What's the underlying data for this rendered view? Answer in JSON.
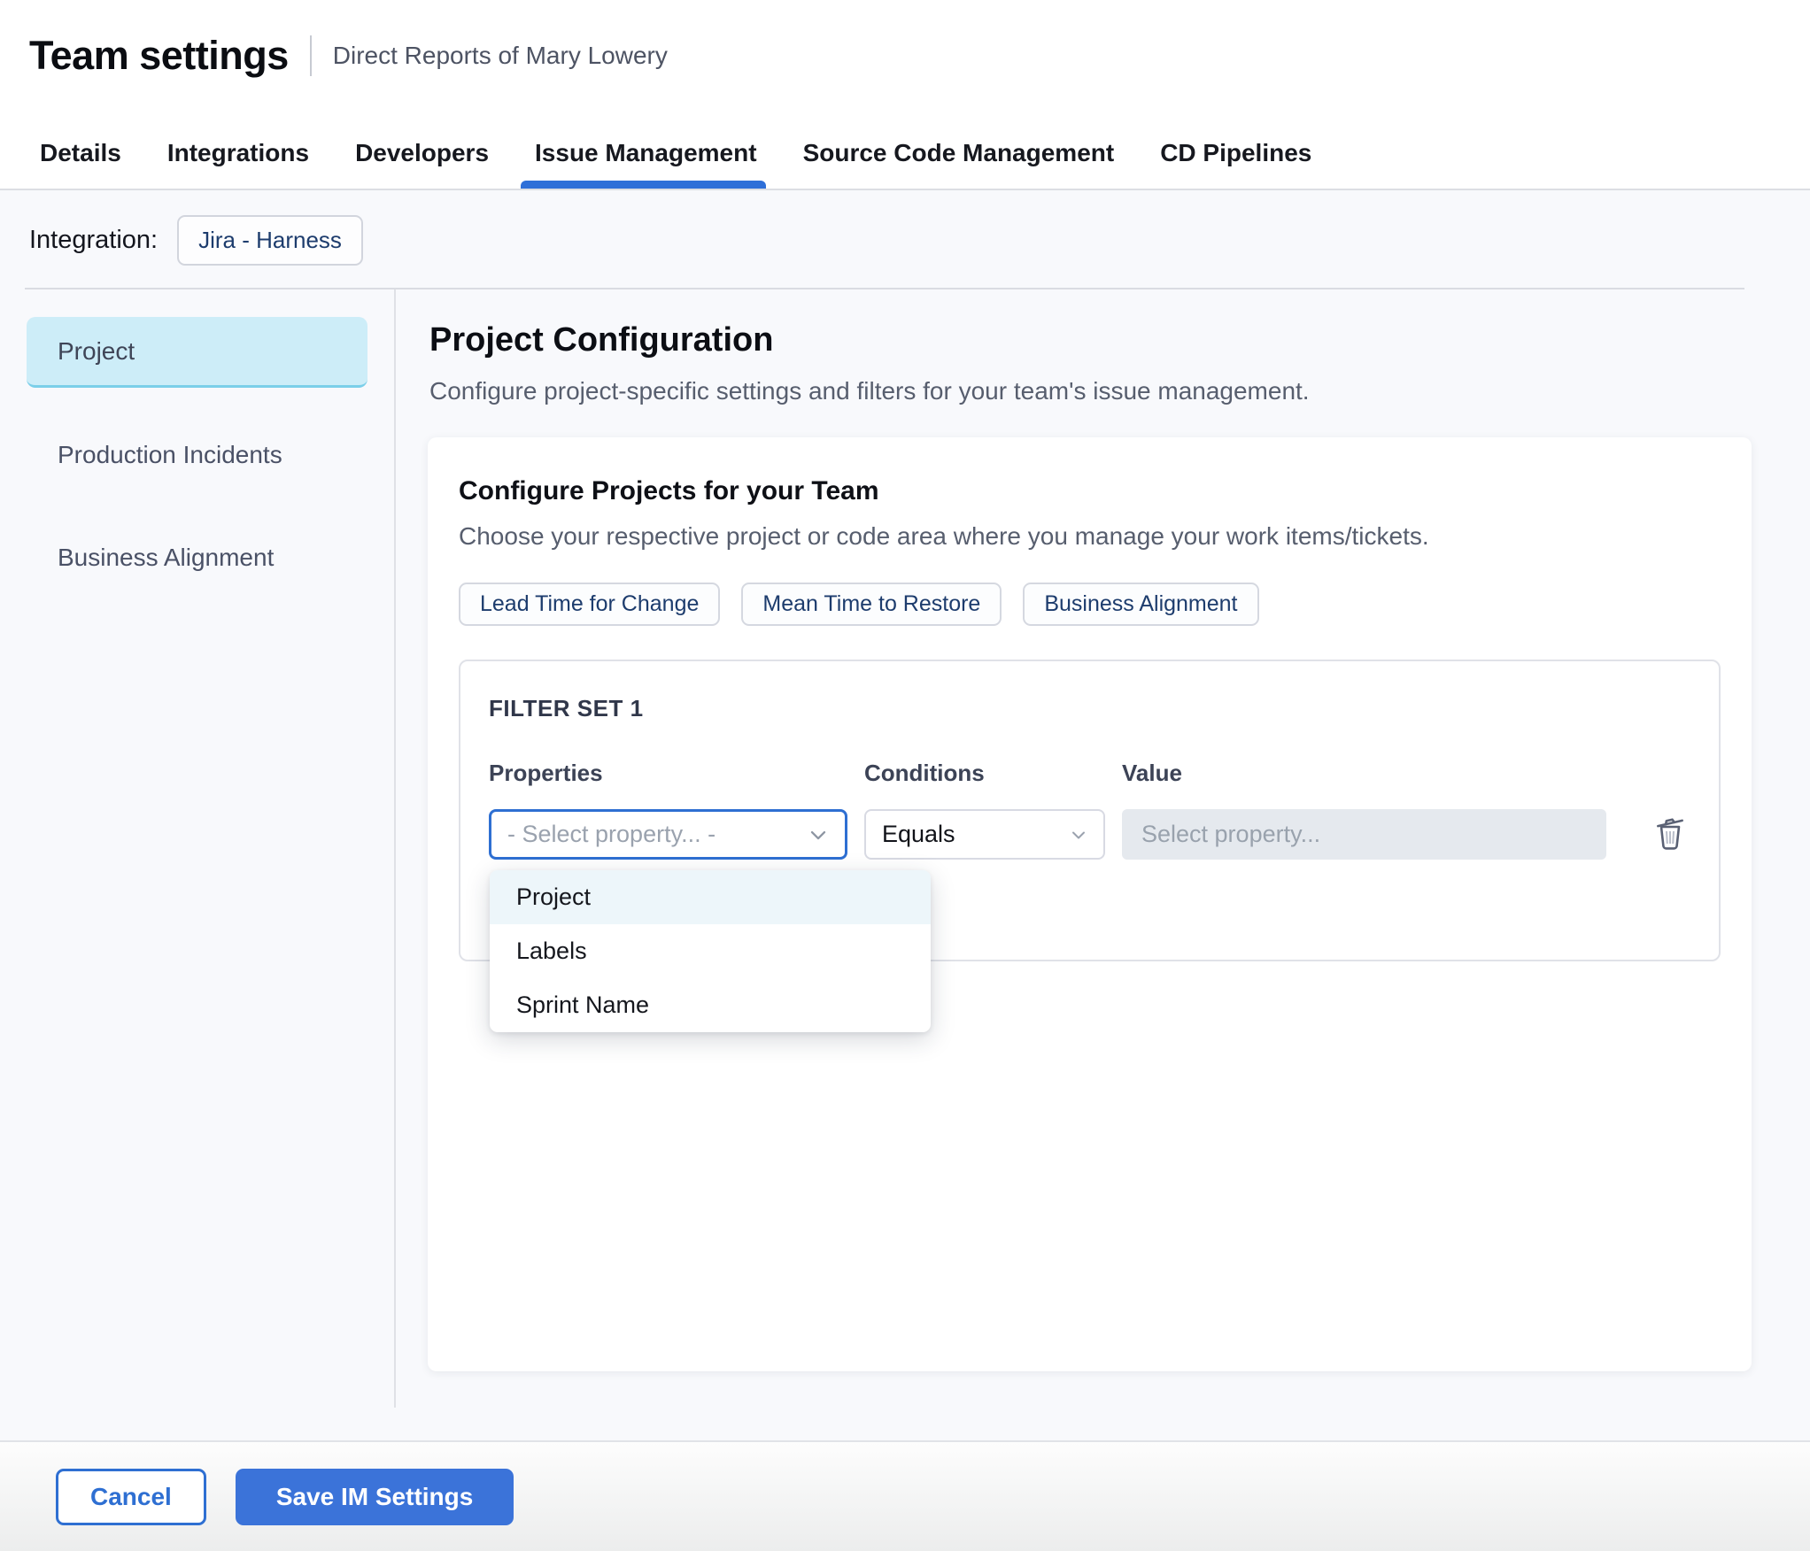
{
  "header": {
    "title": "Team settings",
    "subtitle": "Direct Reports of Mary Lowery"
  },
  "tabs": [
    {
      "label": "Details",
      "active": false
    },
    {
      "label": "Integrations",
      "active": false
    },
    {
      "label": "Developers",
      "active": false
    },
    {
      "label": "Issue Management",
      "active": true
    },
    {
      "label": "Source Code Management",
      "active": false
    },
    {
      "label": "CD Pipelines",
      "active": false
    }
  ],
  "integration": {
    "label": "Integration:",
    "chip": "Jira - Harness"
  },
  "sidebar": {
    "items": [
      {
        "label": "Project",
        "selected": true
      },
      {
        "label": "Production Incidents",
        "selected": false
      },
      {
        "label": "Business Alignment",
        "selected": false
      }
    ]
  },
  "main": {
    "title": "Project Configuration",
    "subtitle": "Configure project-specific settings and filters for your team's issue management.",
    "card": {
      "title": "Configure Projects for your Team",
      "subtitle": "Choose your respective project or code area where you manage your work items/tickets.",
      "chips": [
        "Lead Time for Change",
        "Mean Time to Restore",
        "Business Alignment"
      ],
      "filter_set": {
        "title": "FILTER SET 1",
        "columns": [
          "Properties",
          "Conditions",
          "Value"
        ],
        "properties_placeholder": "- Select property... -",
        "conditions_value": "Equals",
        "value_placeholder": "Select property...",
        "dropdown": {
          "options": [
            "Project",
            "Labels",
            "Sprint Name"
          ],
          "highlighted": "Project"
        }
      }
    }
  },
  "footer": {
    "cancel": "Cancel",
    "save": "Save IM Settings"
  },
  "colors": {
    "accent_blue": "#2e6fd8",
    "save_button_bg": "#3b73d9",
    "sidebar_selected_bg": "#cdedf8",
    "sidebar_selected_border": "#7bcfe9",
    "dropdown_highlight_bg": "#edf6fa",
    "value_field_bg": "#e5e9ee",
    "content_bg": "#f8f9fc",
    "chip_text": "#1d3c6d"
  }
}
